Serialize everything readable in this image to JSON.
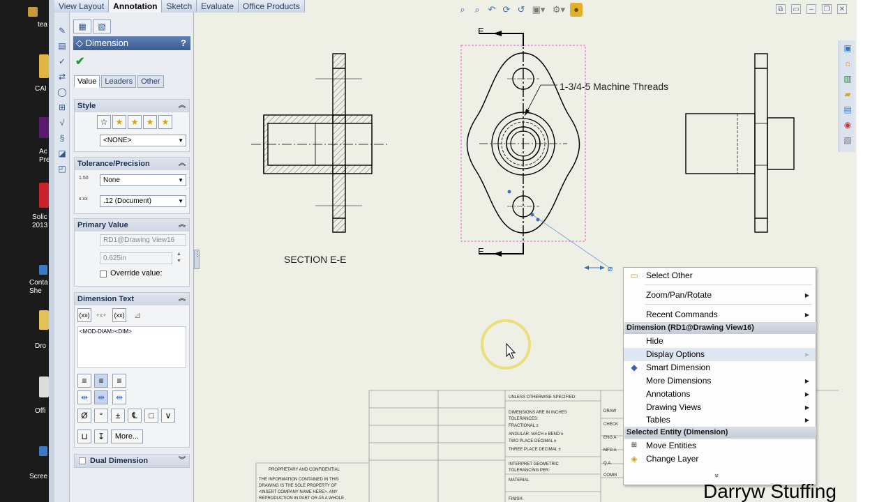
{
  "desktop": {
    "icons": [
      {
        "label": "tea"
      },
      {
        "label": "CAI"
      },
      {
        "label": "Ac Prem"
      },
      {
        "label": "Solic 2013"
      },
      {
        "label": "Conta She"
      },
      {
        "label": "Dro"
      },
      {
        "label": "Offi"
      },
      {
        "label": "Scree"
      }
    ]
  },
  "command_tabs": [
    "View Layout",
    "Annotation",
    "Sketch",
    "Evaluate",
    "Office Products"
  ],
  "active_tab": "Annotation",
  "property_manager": {
    "title": "Dimension",
    "help": "?",
    "subtabs": [
      "Value",
      "Leaders",
      "Other"
    ],
    "style": {
      "header": "Style",
      "favorite": "<NONE>"
    },
    "tolerance": {
      "header": "Tolerance/Precision",
      "tolerance_type": "None",
      "precision": ".12 (Document)",
      "tol_icon_text": "1.50",
      "prec_icon_text": "x.xx"
    },
    "primary_value": {
      "header": "Primary Value",
      "name": "RD1@Drawing View16",
      "value": "0.625in",
      "override_label": "Override value:"
    },
    "dimension_text": {
      "header": "Dimension Text",
      "text": "<MOD-DIAM><DIM>",
      "more_label": "More..."
    },
    "dual_dimension": {
      "header": "Dual Dimension"
    }
  },
  "drawing": {
    "section_label": "SECTION E-E",
    "section_letter_top": "E",
    "section_letter_bottom": "E",
    "note": "1-3/4-5 Machine Threads",
    "title_block": {
      "unless": "UNLESS OTHERWISE SPECIFIED:",
      "dims_line1": "DIMENSIONS ARE IN INCHES",
      "dims_line2": "TOLERANCES:",
      "dims_line3": "FRACTIONAL ±",
      "dims_line4": "ANGULAR: MACH ±    BEND ±",
      "dims_line5": "TWO PLACE DECIMAL   ±",
      "dims_line6": "THREE PLACE DECIMAL  ±",
      "interp1": "INTERPRET GEOMETRIC",
      "interp2": "TOLERANCING PER:",
      "material": "MATERIAL",
      "finish": "FINISH",
      "drawn": "DRAW",
      "checked": "CHECK",
      "eng": "ENG A",
      "mfg": "MFG A",
      "qa": "Q.A.",
      "comments": "COMM",
      "prop_title": "PROPRIETARY AND CONFIDENTIAL",
      "prop_1": "THE INFORMATION CONTAINED IN THIS",
      "prop_2": "DRAWING IS THE SOLE PROPERTY OF",
      "prop_3": "<INSERT COMPANY NAME HERE>. ANY",
      "prop_4": "REPRODUCTION IN PART OR AS A WHOLE"
    }
  },
  "context_menu": {
    "items_top": [
      {
        "label": "Select Other",
        "icon": "select-other-icon",
        "submenu": false
      },
      {
        "label": "Zoom/Pan/Rotate",
        "submenu": true
      },
      {
        "label": "Recent Commands",
        "submenu": true
      }
    ],
    "section1_header": "Dimension (RD1@Drawing View16)",
    "items_dim": [
      {
        "label": "Hide",
        "submenu": false
      },
      {
        "label": "Display Options",
        "submenu": true
      },
      {
        "label": "Smart Dimension",
        "icon": "smart-dimension-icon",
        "submenu": false
      },
      {
        "label": "More Dimensions",
        "submenu": true
      },
      {
        "label": "Annotations",
        "submenu": true
      },
      {
        "label": "Drawing Views",
        "submenu": true
      },
      {
        "label": "Tables",
        "submenu": true
      }
    ],
    "section2_header": "Selected Entity (Dimension)",
    "items_entity": [
      {
        "label": "Move Entities",
        "icon": "move-entities-icon"
      },
      {
        "label": "Change Layer",
        "icon": "change-layer-icon"
      }
    ],
    "expand": "»"
  },
  "watermark": "Darryw Stuffing"
}
